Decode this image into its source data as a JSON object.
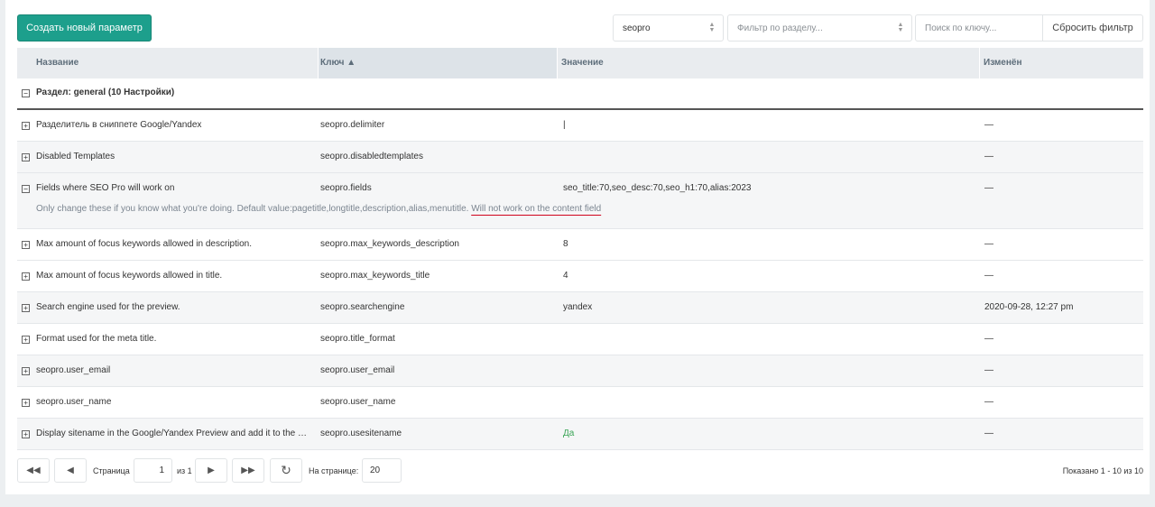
{
  "toolbar": {
    "create_label": "Создать новый параметр",
    "namespace_value": "seopro",
    "area_placeholder": "Фильтр по разделу...",
    "search_placeholder": "Поиск по ключу...",
    "reset_label": "Сбросить фильтр"
  },
  "columns": {
    "name": "Название",
    "key": "Ключ ▲",
    "value": "Значение",
    "modified": "Изменён"
  },
  "group": {
    "label": "Раздел: general (10 Настройки)"
  },
  "rows": [
    {
      "name": "Разделитель в сниппете Google/Yandex",
      "key": "seopro.delimiter",
      "value": "|",
      "modified": "—"
    },
    {
      "name": "Disabled Templates",
      "key": "seopro.disabledtemplates",
      "value": "",
      "modified": "—"
    },
    {
      "name": "Fields where SEO Pro will work on",
      "key": "seopro.fields",
      "value": "seo_title:70,seo_desc:70,seo_h1:70,alias:2023",
      "modified": "—",
      "desc": "Only change these if you know what you're doing. Default value:pagetitle,longtitle,description,alias,menutitle.",
      "desc_highlight": "Will not work on the content field"
    },
    {
      "name": "Max amount of focus keywords allowed in description.",
      "key": "seopro.max_keywords_description",
      "value": "8",
      "modified": "—"
    },
    {
      "name": "Max amount of focus keywords allowed in title.",
      "key": "seopro.max_keywords_title",
      "value": "4",
      "modified": "—"
    },
    {
      "name": "Search engine used for the preview.",
      "key": "seopro.searchengine",
      "value": "yandex",
      "modified": "2020-09-28, 12:27 pm"
    },
    {
      "name": "Format used for the meta title.",
      "key": "seopro.title_format",
      "value": "",
      "modified": "—"
    },
    {
      "name": "seopro.user_email",
      "key": "seopro.user_email",
      "value": "",
      "modified": "—"
    },
    {
      "name": "seopro.user_name",
      "key": "seopro.user_name",
      "value": "",
      "modified": "—"
    },
    {
      "name": "Display sitename in the Google/Yandex Preview and add it to the …",
      "key": "seopro.usesitename",
      "value": "Да",
      "modified": "—"
    }
  ],
  "pager": {
    "page_label": "Страница",
    "page_value": "1",
    "of_label": "из 1",
    "per_page_label": "На странице:",
    "per_page_value": "20",
    "info": "Показано 1 - 10 из 10"
  },
  "colors": {
    "accent": "#1d9f8c",
    "true_value": "#3aa556",
    "highlight_underline": "#d0021b"
  }
}
